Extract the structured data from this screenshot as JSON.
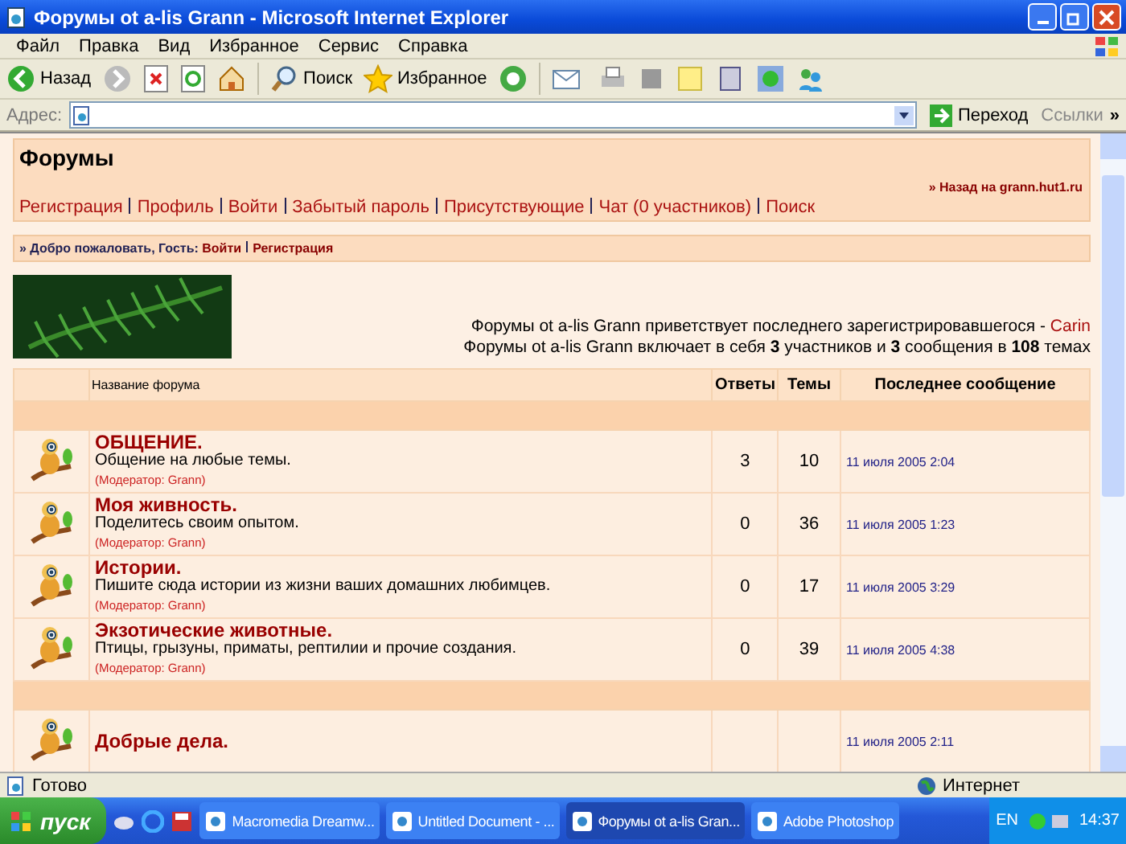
{
  "window": {
    "title": "Форумы ot a-lis Grann - Microsoft Internet Explorer"
  },
  "menu": [
    "Файл",
    "Правка",
    "Вид",
    "Избранное",
    "Сервис",
    "Справка"
  ],
  "toolbar": {
    "back": "Назад",
    "search": "Поиск",
    "favorites": "Избранное"
  },
  "address": {
    "label": "Адрес:",
    "go": "Переход",
    "links": "Ссылки",
    "more": "»"
  },
  "page": {
    "title": "Форумы",
    "back_link": "» Назад на grann.hut1.ru",
    "nav": [
      "Регистрация",
      "Профиль",
      "Войти",
      "Забытый пароль",
      "Присутствующие",
      "Чат (0 участников)",
      "Поиск"
    ],
    "welcome": {
      "text": "» Добро пожаловать, Гость:",
      "links": [
        "Войти",
        "Регистрация"
      ]
    },
    "stats": {
      "line_1": "Форумы ot a-lis Grann приветствует последнего зарегистрировавшегося - ",
      "last_user": "Carin",
      "line_2": "Форумы ot a-lis Grann включает в себя **3** участников и **3** сообщения в **108** темах"
    }
  },
  "table": {
    "columns": [
      "Название форума",
      "Ответы",
      "Темы",
      "Последнее сообщение"
    ],
    "rows": [
      {
        "kind": "category"
      },
      {
        "kind": "forum",
        "title": "ОБЩЕНИЕ.",
        "description": "Общение на любые темы.",
        "moderator": "(Модератор: Grann)",
        "replies": "3",
        "topics": "10",
        "last_post": "11 июля 2005 2:04"
      },
      {
        "kind": "forum",
        "title": "Моя живность.",
        "description": "Поделитесь своим опытом.",
        "moderator": "(Модератор: Grann)",
        "replies": "0",
        "topics": "36",
        "last_post": "11 июля 2005 1:23"
      },
      {
        "kind": "forum",
        "title": "Истории.",
        "description": "Пишите сюда истории из жизни ваших домашних любимцев.",
        "moderator": "(Модератор: Grann)",
        "replies": "0",
        "topics": "17",
        "last_post": "11 июля 2005 3:29"
      },
      {
        "kind": "forum",
        "title": "Экзотические животные.",
        "description": "Птицы, грызуны, приматы, рептилии и прочие создания.",
        "moderator": "(Модератор: Grann)",
        "replies": "0",
        "topics": "39",
        "last_post": "11 июля 2005 4:38"
      },
      {
        "kind": "category"
      },
      {
        "kind": "forum",
        "title": "Добрые дела.",
        "last_post": "11 июля 2005 2:11"
      }
    ]
  },
  "status_bar": {
    "text": "Готово",
    "zone": "Интернет"
  },
  "taskbar": {
    "start": "пуск",
    "tasks": [
      {
        "label": "Macromedia Dreamw...",
        "selected": false
      },
      {
        "label": "Untitled Document - ...",
        "selected": false
      },
      {
        "label": "Форумы ot a-lis Gran...",
        "selected": true
      },
      {
        "label": "Adobe Photoshop",
        "selected": false
      }
    ],
    "lang": "EN",
    "clock": "14:37"
  }
}
